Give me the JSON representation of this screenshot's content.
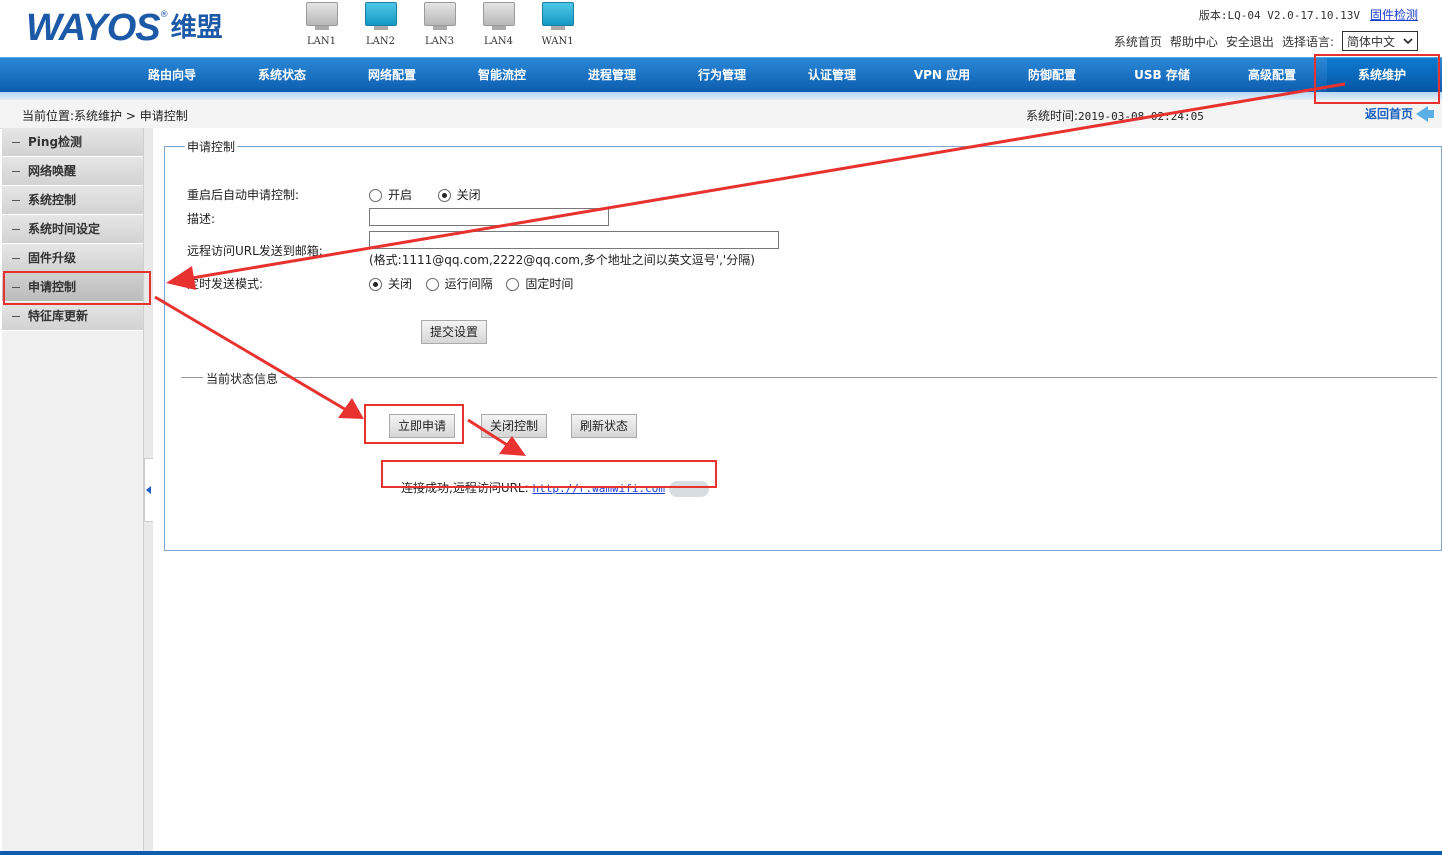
{
  "header": {
    "logo_en": "WAYOS",
    "logo_reg": "®",
    "logo_cn": "维盟",
    "ports": [
      {
        "label": "LAN1",
        "active": false
      },
      {
        "label": "LAN2",
        "active": true
      },
      {
        "label": "LAN3",
        "active": false
      },
      {
        "label": "LAN4",
        "active": false
      },
      {
        "label": "WAN1",
        "active": true
      }
    ],
    "version_text": "版本:LQ-04 V2.0-17.10.13V",
    "firmware_check": "固件检测",
    "links": [
      "系统首页",
      "帮助中心",
      "安全退出"
    ],
    "lang_label": "选择语言:",
    "lang_value": "简体中文"
  },
  "nav": {
    "items": [
      "路由向导",
      "系统状态",
      "网络配置",
      "智能流控",
      "进程管理",
      "行为管理",
      "认证管理",
      "VPN 应用",
      "防御配置",
      "USB 存储",
      "高级配置",
      "系统维护"
    ],
    "active_index": 11
  },
  "breadcrumb": {
    "text": "当前位置:系统维护 > 申请控制",
    "time_label": "系统时间:",
    "time_value": "2019-03-08 02:24:05",
    "back_label": "返回首页"
  },
  "sidebar": {
    "items": [
      "Ping检测",
      "网络唤醒",
      "系统控制",
      "系统时间设定",
      "固件升级",
      "申请控制",
      "特征库更新"
    ],
    "active_index": 5
  },
  "panel": {
    "legend": "申请控制",
    "auto_apply_label": "重启后自动申请控制:",
    "auto_apply_on": "开启",
    "auto_apply_off": "关闭",
    "auto_apply_value": "关闭",
    "desc_label": "描述:",
    "desc_value": "",
    "email_label": "远程访问URL发送到邮箱:",
    "email_value": "",
    "email_hint": "(格式:1111@qq.com,2222@qq.com,多个地址之间以英文逗号','分隔)",
    "send_mode_label": "定时发送模式:",
    "send_mode_options": [
      "关闭",
      "运行间隔",
      "固定时间"
    ],
    "send_mode_value": "关闭",
    "submit_label": "提交设置",
    "status_legend": "当前状态信息",
    "apply_now": "立即申请",
    "close_control": "关闭控制",
    "refresh_status": "刷新状态",
    "result_text": "连接成功,远程访问URL:",
    "result_url": "http://r.wamwifi.com"
  },
  "colors": {
    "nav_blue": "#0d5cae",
    "annotation_red": "#e8322f",
    "link_blue": "#1a3fd2"
  }
}
